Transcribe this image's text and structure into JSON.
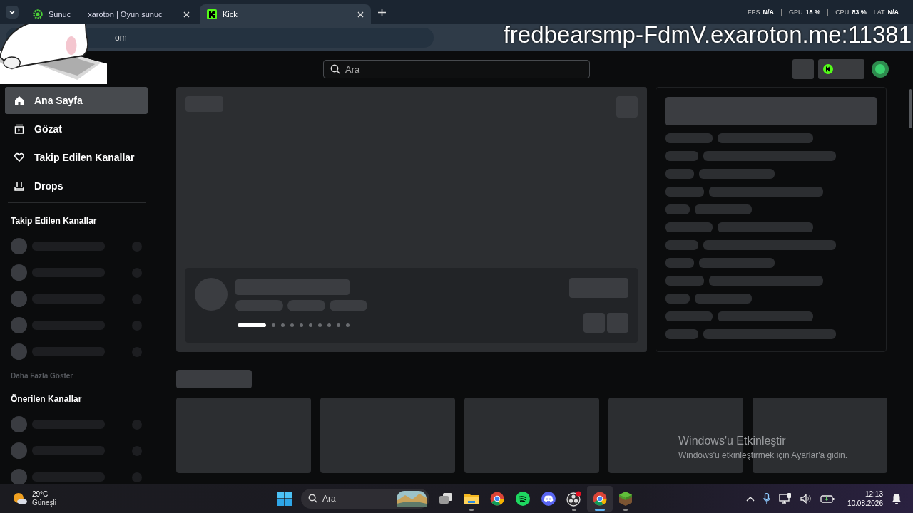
{
  "browser": {
    "tabs": [
      {
        "title_parts": [
          "Sunuc",
          "xaroton | Oyun sunuc"
        ],
        "selected": false
      },
      {
        "title_parts": [
          "Kick"
        ],
        "selected": true
      }
    ],
    "address": "om",
    "perf_overlay": [
      {
        "label": "FPS",
        "value": "N/A"
      },
      {
        "label": "GPU",
        "value": "18 %"
      },
      {
        "label": "CPU",
        "value": "83 %"
      },
      {
        "label": "LAT",
        "value": "N/A"
      }
    ],
    "stream_overlay": "fredbearsmp-FdmV.exaroton.me:11381"
  },
  "header": {
    "search": {
      "placeholder": "Ara"
    }
  },
  "sidebar": {
    "nav": [
      {
        "label": "Ana Sayfa",
        "selected": true
      },
      {
        "label": "Gözat",
        "selected": false
      },
      {
        "label": "Takip Edilen Kanallar",
        "selected": false
      },
      {
        "label": "Drops",
        "selected": false
      }
    ],
    "sections": [
      {
        "title": "Takip Edilen Kanallar",
        "more": "Daha Fazla Göster"
      },
      {
        "title": "Önerilen Kanallar"
      }
    ]
  },
  "carousel": {
    "dots": [
      {
        "selected": true
      },
      {
        "selected": false
      },
      {
        "selected": false
      },
      {
        "selected": false
      },
      {
        "selected": false
      },
      {
        "selected": false
      },
      {
        "selected": false
      },
      {
        "selected": false
      },
      {
        "selected": false
      },
      {
        "selected": false
      }
    ]
  },
  "activation": {
    "title": "Windows'u Etkinleştir",
    "message": "Windows'u etkinleştirmek için Ayarlar'a gidin."
  },
  "taskbar": {
    "weather": {
      "temp": "29°C",
      "condition": "Güneşli"
    },
    "search": {
      "placeholder": "Ara"
    },
    "apps": [
      {
        "kind": "taskview",
        "selected": false,
        "running": false
      },
      {
        "kind": "folder",
        "selected": false,
        "running": true
      },
      {
        "kind": "chrome",
        "selected": false,
        "running": false
      },
      {
        "kind": "spotify",
        "selected": false,
        "running": false
      },
      {
        "kind": "discord",
        "selected": false,
        "running": false
      },
      {
        "kind": "obs",
        "selected": false,
        "running": true
      },
      {
        "kind": "chrome",
        "selected": true,
        "running": true
      },
      {
        "kind": "block",
        "selected": false,
        "running": true
      }
    ],
    "time": "12:13",
    "date": "10.08.2026"
  }
}
